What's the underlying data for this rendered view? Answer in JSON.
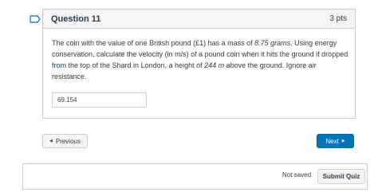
{
  "question": {
    "title": "Question 11",
    "points": "3 pts",
    "text_parts": {
      "p1": "The coin with the value of one British pound (£1) has a mass of ",
      "mass": "8.75 grams",
      "p2": ". Using energy conservation, calculate the velocity (in m/s) of a pound coin when it hits the ground if dropped from the top of the Shard in London, a height of ",
      "height": "244 m",
      "p3": " above the ground.  Ignore air resistance."
    },
    "answer_value": "69.154"
  },
  "nav": {
    "previous_label": "Previous",
    "next_label": "Next"
  },
  "footer": {
    "status": "Not saved",
    "submit_label": "Submit Quiz"
  },
  "colors": {
    "primary": "#0374b5",
    "flag": "#0374b5",
    "text": "#2d3b45",
    "border": "#c7cdd1"
  },
  "icons": {
    "flag": "bookmark-flag-icon",
    "prev": "caret-left-icon",
    "next": "caret-right-icon"
  }
}
